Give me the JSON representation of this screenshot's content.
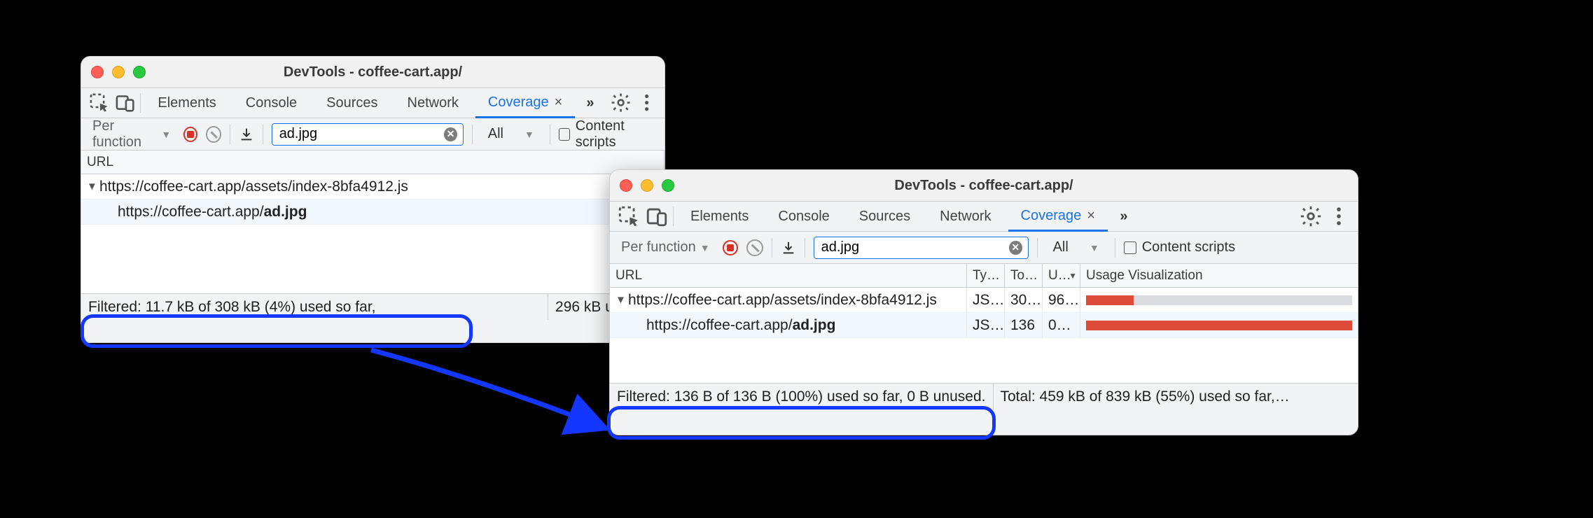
{
  "window1": {
    "title": "DevTools - coffee-cart.app/",
    "tabs": [
      "Elements",
      "Console",
      "Sources",
      "Network",
      "Coverage"
    ],
    "active_tab": "Coverage",
    "granularity": "Per function",
    "filter_value": "ad.jpg",
    "type_filter": "All",
    "content_scripts_label": "Content scripts",
    "headers": {
      "url": "URL"
    },
    "rows": [
      {
        "url_prefix": "https://coffee-cart.app/assets/index-8bfa4912.js",
        "bold": "",
        "expandable": true
      },
      {
        "url_prefix": "https://coffee-cart.app/",
        "bold": "ad.jpg",
        "expandable": false
      }
    ],
    "status_filtered": "Filtered: 11.7 kB of 308 kB (4%) used so far,",
    "status_trail": "296 kB unused."
  },
  "window2": {
    "title": "DevTools - coffee-cart.app/",
    "tabs": [
      "Elements",
      "Console",
      "Sources",
      "Network",
      "Coverage"
    ],
    "active_tab": "Coverage",
    "granularity": "Per function",
    "filter_value": "ad.jpg",
    "type_filter": "All",
    "content_scripts_label": "Content scripts",
    "headers": {
      "url": "URL",
      "type": "Ty…",
      "total": "To…",
      "unused": "U…",
      "viz": "Usage Visualization"
    },
    "rows": [
      {
        "url_prefix": "https://coffee-cart.app/assets/index-8bfa4912.js",
        "bold": "",
        "type": "JS…",
        "total": "30…",
        "unused": "96…",
        "used_pct": 4,
        "expandable": true
      },
      {
        "url_prefix": "https://coffee-cart.app/",
        "bold": "ad.jpg",
        "type": "JS…",
        "total": "136",
        "unused": "0…",
        "used_pct": 1,
        "expandable": false
      }
    ],
    "status_filtered": "Filtered: 136 B of 136 B (100%) used so far, 0 B unused.",
    "status_total": "Total: 459 kB of 839 kB (55%) used so far,…"
  }
}
